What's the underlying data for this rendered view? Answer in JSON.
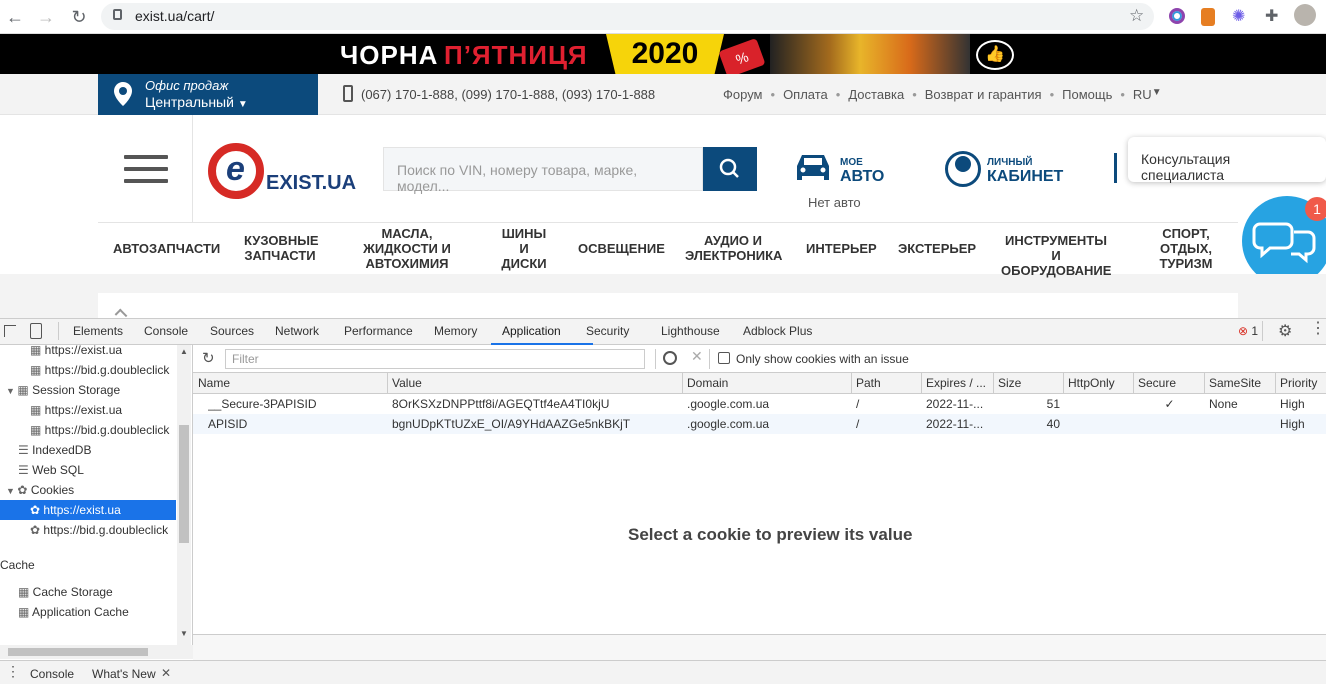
{
  "browser": {
    "url": "exist.ua/cart/"
  },
  "banner": {
    "title_white": "ЧОРНА",
    "title_red": "П’ЯТНИЦЯ",
    "year": "2020",
    "sale": "%"
  },
  "infobar": {
    "office_label": "Офис продаж",
    "office_value": "Центральный",
    "phones": "(067) 170-1-888,  (099) 170-1-888,  (093) 170-1-888",
    "links": [
      "Форум",
      "Оплата",
      "Доставка",
      "Возврат и гарантия",
      "Помощь",
      "RU"
    ]
  },
  "header": {
    "logo": "EXIST.UA",
    "logo_e": "e",
    "search_placeholder": "Поиск по VIN, номеру товара, марке, модел...",
    "car_small": "МОЕ",
    "car_big": "АВТО",
    "car_status": "Нет авто",
    "account_small": "ЛИЧНЫЙ",
    "account_big": "КАБИНЕТ",
    "consult": "Консультация специалиста",
    "chat_badge": "1"
  },
  "categories": [
    "АВТОЗАПЧАСТИ",
    "КУЗОВНЫЕ\nЗАПЧАСТИ",
    "МАСЛА,\nЖИДКОСТИ И\nАВТОХИМИЯ",
    "ШИНЫ\nИ\nДИСКИ",
    "ОСВЕЩЕНИЕ",
    "АУДИО И\nЭЛЕКТРОНИКА",
    "ИНТЕРЬЕР",
    "ЭКСТЕРЬЕР",
    "ИНСТРУМЕНТЫ И\nОБОРУДОВАНИЕ",
    "СПОРТ,\nОТДЫХ,\nТУРИЗМ"
  ],
  "devtools": {
    "tabs": [
      "Elements",
      "Console",
      "Sources",
      "Network",
      "Performance",
      "Memory",
      "Application",
      "Security",
      "Lighthouse",
      "Adblock Plus"
    ],
    "active_tab": "Application",
    "error_count": "1",
    "tree": [
      {
        "label": "https://exist.ua",
        "indent": 2,
        "icon": "grid"
      },
      {
        "label": "https://bid.g.doubleclick",
        "indent": 2,
        "icon": "grid"
      },
      {
        "label": "Session Storage",
        "indent": 1,
        "icon": "grid",
        "arrow": "▼"
      },
      {
        "label": "https://exist.ua",
        "indent": 2,
        "icon": "grid"
      },
      {
        "label": "https://bid.g.doubleclick",
        "indent": 2,
        "icon": "grid"
      },
      {
        "label": "IndexedDB",
        "indent": 1,
        "icon": "db"
      },
      {
        "label": "Web SQL",
        "indent": 1,
        "icon": "db"
      },
      {
        "label": "Cookies",
        "indent": 1,
        "icon": "cookie",
        "arrow": "▼"
      },
      {
        "label": "https://exist.ua",
        "indent": 2,
        "icon": "cookie",
        "selected": true
      },
      {
        "label": "https://bid.g.doubleclick",
        "indent": 2,
        "icon": "cookie"
      }
    ],
    "cache_heading": "Cache",
    "cache_items": [
      "Cache Storage",
      "Application Cache"
    ],
    "filter_placeholder": "Filter",
    "only_issues_label": "Only show cookies with an issue",
    "columns": [
      "Name",
      "Value",
      "Domain",
      "Path",
      "Expires / ...",
      "Size",
      "HttpOnly",
      "Secure",
      "SameSite",
      "Priority"
    ],
    "rows": [
      {
        "name": "__Secure-3PAPISID",
        "value": "8OrKSXzDNPPttf8i/AGEQTtf4eA4TI0kjU",
        "domain": ".google.com.ua",
        "path": "/",
        "expires": "2022-11-...",
        "size": "51",
        "httponly": "",
        "secure": "✓",
        "samesite": "None",
        "priority": "High"
      },
      {
        "name": "APISID",
        "value": "bgnUDpKTtUZxE_OI/A9YHdAAZGe5nkBKjT",
        "domain": ".google.com.ua",
        "path": "/",
        "expires": "2022-11-...",
        "size": "40",
        "httponly": "",
        "secure": "",
        "samesite": "",
        "priority": "High"
      }
    ],
    "preview": "Select a cookie to preview its value",
    "drawer_tabs": [
      "Console",
      "What's New"
    ]
  }
}
